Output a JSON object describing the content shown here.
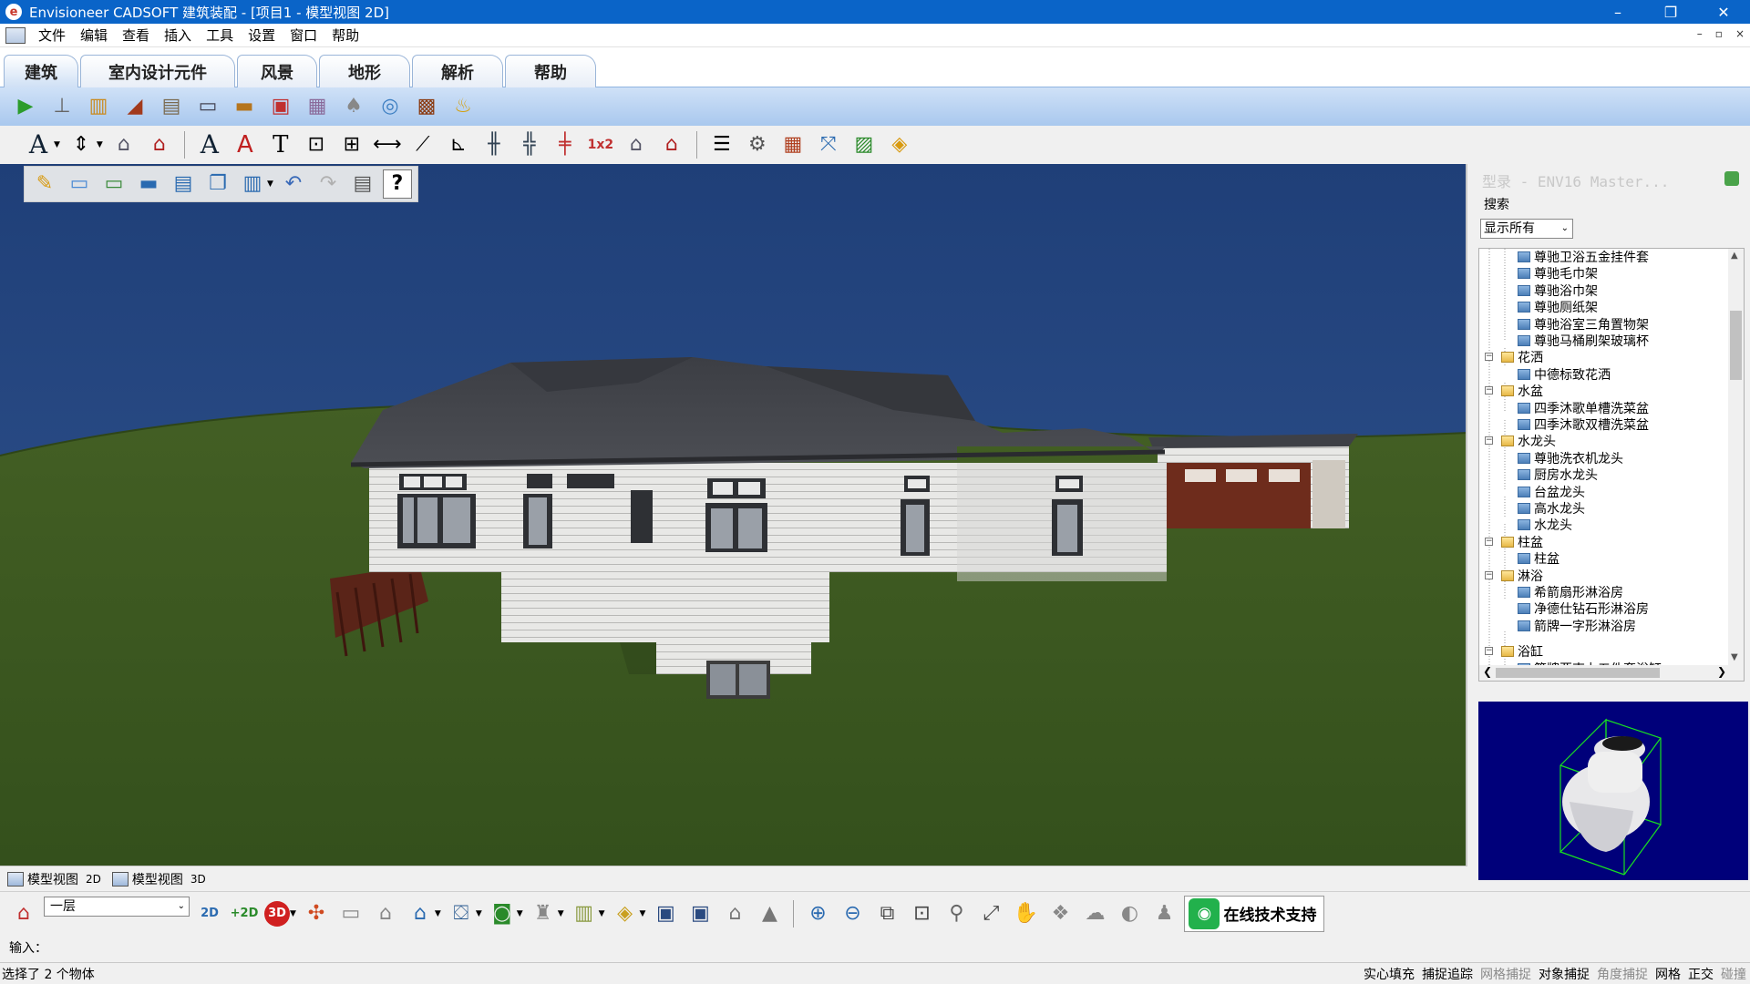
{
  "window": {
    "title": "Envisioneer CADSOFT 建筑装配 - [项目1 - 模型视图 2D]",
    "controls": [
      "–",
      "❐",
      "✕"
    ],
    "mdi_controls": [
      "–",
      "▫",
      "×"
    ]
  },
  "menu": [
    "文件",
    "编辑",
    "查看",
    "插入",
    "工具",
    "设置",
    "窗口",
    "帮助"
  ],
  "ribbon_tabs": [
    {
      "label": "建筑",
      "active": true
    },
    {
      "label": "室内设计元件",
      "active": false
    },
    {
      "label": "风景",
      "active": false
    },
    {
      "label": "地形",
      "active": false
    },
    {
      "label": "解析",
      "active": false
    },
    {
      "label": "帮助",
      "active": false
    }
  ],
  "library_panel": {
    "title": "型录 - ENV16 Master...",
    "search_label": "搜索",
    "filter_value": "显示所有",
    "tree": [
      {
        "label": "尊驰卫浴五金挂件套",
        "type": "item"
      },
      {
        "label": "尊驰毛巾架",
        "type": "item"
      },
      {
        "label": "尊驰浴巾架",
        "type": "item"
      },
      {
        "label": "尊驰厕纸架",
        "type": "item"
      },
      {
        "label": "尊驰浴室三角置物架",
        "type": "item"
      },
      {
        "label": "尊驰马桶刷架玻璃杯",
        "type": "item"
      },
      {
        "label": "花洒",
        "type": "folder"
      },
      {
        "label": "中德标致花洒",
        "type": "item"
      },
      {
        "label": "水盆",
        "type": "folder"
      },
      {
        "label": "四季沐歌单槽洗菜盆",
        "type": "item"
      },
      {
        "label": "四季沐歌双槽洗菜盆",
        "type": "item"
      },
      {
        "label": "水龙头",
        "type": "folder"
      },
      {
        "label": "尊驰洗衣机龙头",
        "type": "item"
      },
      {
        "label": "厨房水龙头",
        "type": "item"
      },
      {
        "label": "台盆龙头",
        "type": "item"
      },
      {
        "label": "高水龙头",
        "type": "item"
      },
      {
        "label": "水龙头",
        "type": "item"
      },
      {
        "label": "柱盆",
        "type": "folder"
      },
      {
        "label": "柱盆",
        "type": "item"
      },
      {
        "label": "淋浴",
        "type": "folder"
      },
      {
        "label": "希箭扇形淋浴房",
        "type": "item"
      },
      {
        "label": "净德仕钻石形淋浴房",
        "type": "item"
      },
      {
        "label": "箭牌一字形淋浴房",
        "type": "item"
      },
      {
        "label": "浴缸",
        "type": "folder"
      },
      {
        "label": "箭牌亚克力五件套浴缸",
        "type": "item"
      }
    ]
  },
  "view_tabs": [
    {
      "label": "模型视图",
      "suffix": "2D"
    },
    {
      "label": "模型视图",
      "suffix": "3D"
    }
  ],
  "floor_select": "一层",
  "support_button": "在线技术支持",
  "command": {
    "label": "输入："
  },
  "status": {
    "message": "选择了 2 个物体",
    "toggles": [
      {
        "label": "实心填充",
        "on": true
      },
      {
        "label": "捕捉追踪",
        "on": true
      },
      {
        "label": "网格捕捉",
        "on": false
      },
      {
        "label": "对象捕捉",
        "on": true
      },
      {
        "label": "角度捕捉",
        "on": false
      },
      {
        "label": "网格",
        "on": true
      },
      {
        "label": "正交",
        "on": true
      },
      {
        "label": "碰撞",
        "on": false
      }
    ]
  },
  "colors": {
    "titlebar": "#0a64c8",
    "sky": "#2a4c86",
    "grass": "#3e5a22",
    "roof": "#45474d",
    "siding": "#e6e6e4",
    "garage": "#6e2c1c",
    "preview_bg": "#00007a",
    "preview_lines": "#18e020"
  },
  "icons": {
    "toolbar1": [
      "select-arrow-icon",
      "paint-brush-icon",
      "cabinet-icon",
      "piano-icon",
      "printer-icon",
      "tv-icon",
      "sofa-icon",
      "toilet-icon",
      "chair-icon",
      "lamp-icon",
      "appliance-icon",
      "fireplace-icon",
      "faucet-icon"
    ],
    "toolbar2": [
      "text-icon",
      "dimension-icon",
      "house-help-icon",
      "house-question-icon",
      "text-icon",
      "text-edit-icon",
      "text-style-icon",
      "dimension-icon",
      "dimension-cross-icon",
      "linear-dimension-icon",
      "angle-dimension-icon",
      "ordinate-icon",
      "railing-icon",
      "stair-icon",
      "fence-icon",
      "scale-1x2-icon",
      "elevation-icon",
      "roof-question-icon",
      "list-icon",
      "settings-icon",
      "building-icon",
      "fit-icon",
      "report-icon",
      "layers-icon"
    ],
    "toolbar3": [
      "new-project-icon",
      "open-folder-icon",
      "open-web-icon",
      "folder-icon",
      "save-icon",
      "copy-icon",
      "book-icon",
      "undo-icon",
      "redo-icon",
      "print-icon",
      "help-icon"
    ],
    "toolbar4": [
      "house-icon",
      "2d-view-icon",
      "2d-grid-icon",
      "3d-view-icon",
      "render-icon",
      "presentation-icon",
      "house-icon",
      "house-outline-icon",
      "roof-icon",
      "camera-icon",
      "lamp-icon",
      "wall-icon",
      "cube-icon",
      "window-icon",
      "window2-icon",
      "house-icon",
      "landscape-icon",
      "zoom-in-icon",
      "zoom-out-icon",
      "zoom-box-icon",
      "zoom-fit-icon",
      "zoom-icon",
      "zoom-extents-icon",
      "pan-hand-icon",
      "walk-icon",
      "orbit-icon",
      "cloud-icon",
      "helmet-icon",
      "robot-icon"
    ]
  }
}
